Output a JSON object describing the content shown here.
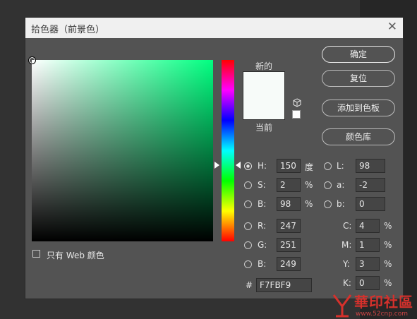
{
  "window": {
    "title": "拾色器（前景色）"
  },
  "preview": {
    "new_label": "新的",
    "current_label": "当前",
    "color": "#F7FBF9"
  },
  "buttons": {
    "ok": "确定",
    "reset": "复位",
    "add_to_swatches": "添加到色板",
    "color_libraries": "颜色库"
  },
  "hsb": {
    "h": {
      "label": "H:",
      "value": "150",
      "unit": "度",
      "selected": true
    },
    "s": {
      "label": "S:",
      "value": "2",
      "unit": "%"
    },
    "b": {
      "label": "B:",
      "value": "98",
      "unit": "%"
    }
  },
  "lab": {
    "l": {
      "label": "L:",
      "value": "98"
    },
    "a": {
      "label": "a:",
      "value": "-2"
    },
    "b": {
      "label": "b:",
      "value": "0"
    }
  },
  "rgb": {
    "r": {
      "label": "R:",
      "value": "247"
    },
    "g": {
      "label": "G:",
      "value": "251"
    },
    "b": {
      "label": "B:",
      "value": "249"
    }
  },
  "cmyk": {
    "c": {
      "label": "C:",
      "value": "4",
      "unit": "%"
    },
    "m": {
      "label": "M:",
      "value": "1",
      "unit": "%"
    },
    "y": {
      "label": "Y:",
      "value": "3",
      "unit": "%"
    },
    "k": {
      "label": "K:",
      "value": "0",
      "unit": "%"
    }
  },
  "hex": {
    "label": "#",
    "value": "F7FBF9"
  },
  "web_only": {
    "label": "只有 Web 颜色",
    "checked": false
  },
  "watermark": {
    "name": "華印社區",
    "url": "www.52cnp.com"
  },
  "colors": {
    "dialog_bg": "#535353",
    "hue_pure": "#00FF80"
  }
}
